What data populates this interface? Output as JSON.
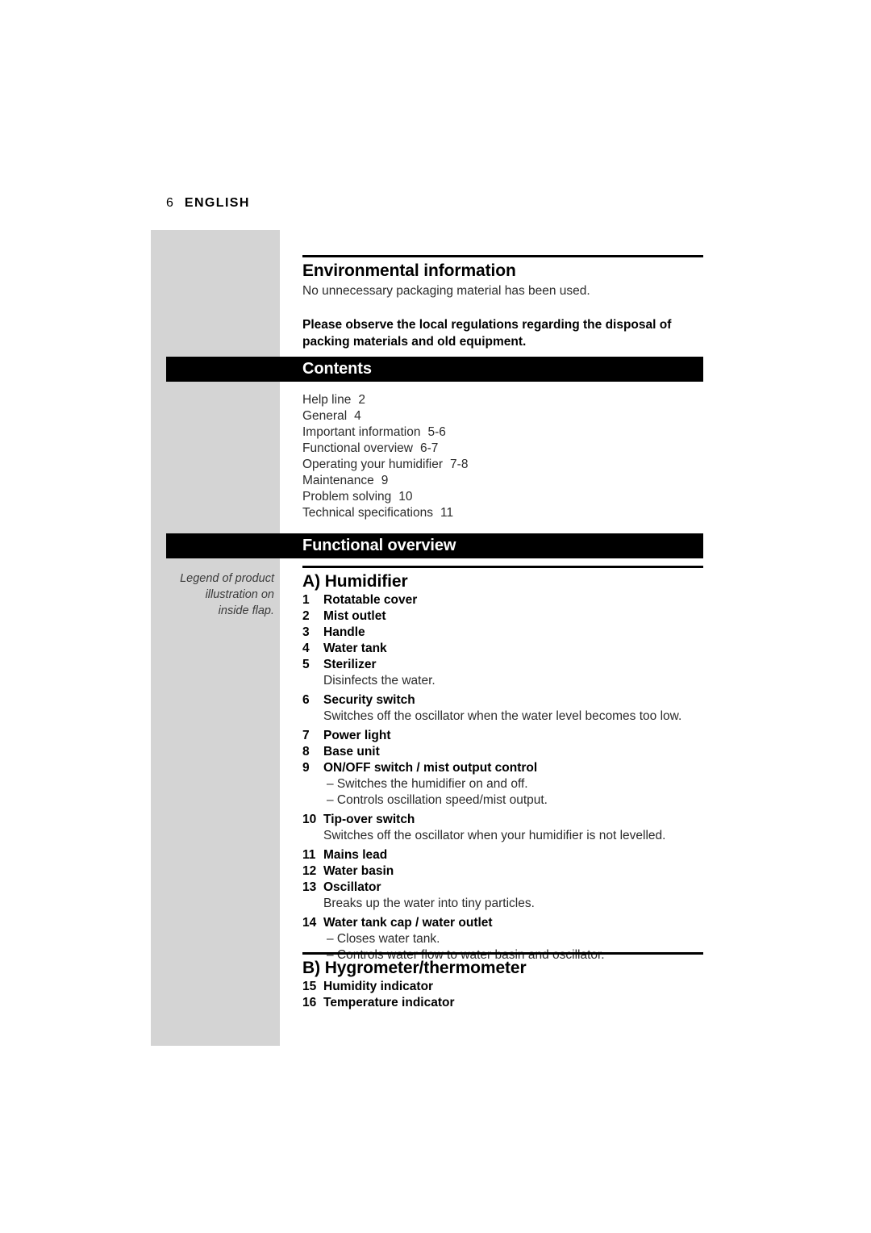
{
  "page": {
    "number": "6",
    "language": "ENGLISH"
  },
  "margin_note": {
    "line1": "Legend of product",
    "line2": "illustration on",
    "line3": "inside flap."
  },
  "environmental": {
    "title": "Environmental information",
    "paragraph": "No unnecessary packaging material has been used.",
    "notice_line1": "Please observe the local regulations regarding the disposal of",
    "notice_line2": "packing materials and old equipment."
  },
  "contents": {
    "band_label": "Contents",
    "entries": [
      {
        "label": "Help line",
        "pages": "2"
      },
      {
        "label": "General",
        "pages": "4"
      },
      {
        "label": "Important information",
        "pages": "5-6"
      },
      {
        "label": "Functional overview",
        "pages": "6-7"
      },
      {
        "label": "Operating your humidifier",
        "pages": "7-8"
      },
      {
        "label": "Maintenance",
        "pages": "9"
      },
      {
        "label": "Problem solving",
        "pages": "10"
      },
      {
        "label": "Technical specifications",
        "pages": "11"
      }
    ]
  },
  "functional_overview": {
    "band_label": "Functional overview",
    "section_a": {
      "title": "A) Humidifier",
      "items": [
        {
          "num": "1",
          "label": "Rotatable cover",
          "desc": null,
          "subs": []
        },
        {
          "num": "2",
          "label": "Mist outlet",
          "desc": null,
          "subs": []
        },
        {
          "num": "3",
          "label": "Handle",
          "desc": null,
          "subs": []
        },
        {
          "num": "4",
          "label": "Water tank",
          "desc": null,
          "subs": []
        },
        {
          "num": "5",
          "label": "Sterilizer",
          "desc": "Disinfects the water.",
          "subs": []
        },
        {
          "num": "6",
          "label": "Security switch",
          "desc": "Switches off the oscillator when the water level becomes too low.",
          "subs": []
        },
        {
          "num": "7",
          "label": "Power light",
          "desc": null,
          "subs": []
        },
        {
          "num": "8",
          "label": "Base unit",
          "desc": null,
          "subs": []
        },
        {
          "num": "9",
          "label": "ON/OFF switch / mist output control",
          "desc": null,
          "subs": [
            "– Switches the humidifier on and off.",
            "– Controls oscillation speed/mist output."
          ]
        },
        {
          "num": "10",
          "label": "Tip-over switch",
          "desc": "Switches off the oscillator when your humidifier is not levelled.",
          "subs": []
        },
        {
          "num": "11",
          "label": "Mains lead",
          "desc": null,
          "subs": []
        },
        {
          "num": "12",
          "label": "Water basin",
          "desc": null,
          "subs": []
        },
        {
          "num": "13",
          "label": "Oscillator",
          "desc": "Breaks up the water into tiny particles.",
          "subs": []
        },
        {
          "num": "14",
          "label": "Water tank cap / water outlet",
          "desc": null,
          "subs": [
            "– Closes water tank.",
            "– Controls water flow to water basin and oscillator."
          ]
        }
      ]
    },
    "section_b": {
      "title": "B) Hygrometer/thermometer",
      "items": [
        {
          "num": "15",
          "label": "Humidity indicator",
          "desc": null,
          "subs": []
        },
        {
          "num": "16",
          "label": "Temperature indicator",
          "desc": null,
          "subs": []
        }
      ]
    }
  },
  "colors": {
    "margin_gray": "#d4d4d4",
    "band_black": "#000000",
    "text_body": "#2b2b2b"
  }
}
